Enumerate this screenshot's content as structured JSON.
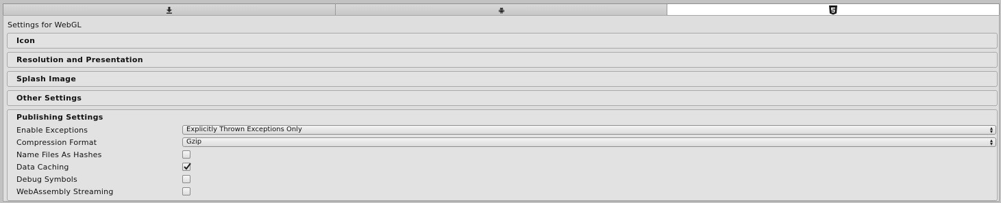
{
  "tabs": [
    {
      "icon": "download-icon",
      "active": false
    },
    {
      "icon": "android-icon",
      "active": false
    },
    {
      "icon": "html5-icon",
      "active": true
    }
  ],
  "settings_title": "Settings for WebGL",
  "sections": {
    "icon": "Icon",
    "resolution": "Resolution and Presentation",
    "splash": "Splash Image",
    "other": "Other Settings",
    "publishing": "Publishing Settings"
  },
  "publishing": {
    "enable_exceptions": {
      "label": "Enable Exceptions",
      "value": "Explicitly Thrown Exceptions Only"
    },
    "compression_format": {
      "label": "Compression Format",
      "value": "Gzip"
    },
    "name_files_as_hashes": {
      "label": "Name Files As Hashes",
      "checked": false
    },
    "data_caching": {
      "label": "Data Caching",
      "checked": true
    },
    "debug_symbols": {
      "label": "Debug Symbols",
      "checked": false
    },
    "webassembly_streaming": {
      "label": "WebAssembly Streaming",
      "checked": false
    }
  },
  "colors": {
    "background": "#c2c2c2",
    "panel": "#dedede",
    "active_tab": "#ffffff"
  }
}
